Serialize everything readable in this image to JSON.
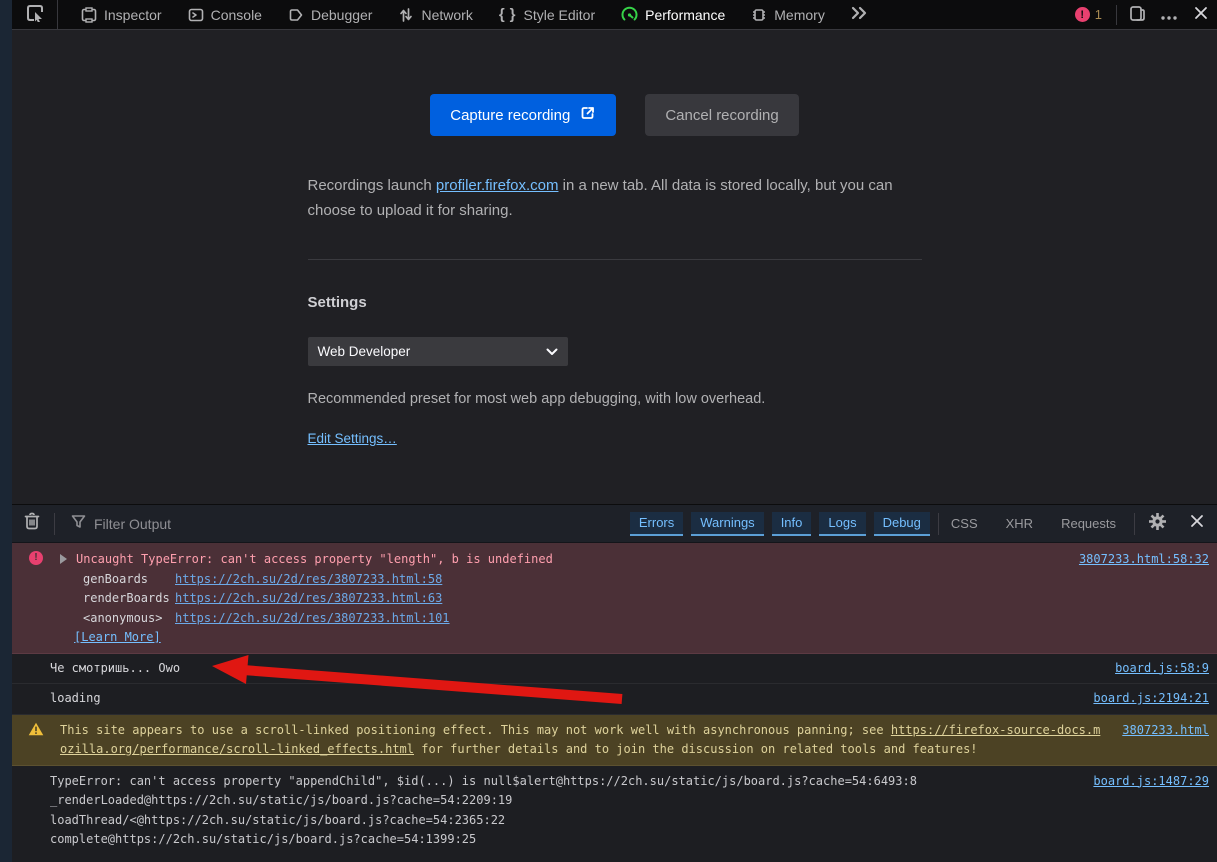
{
  "colors": {
    "accent_blue": "#0060df",
    "link_blue": "#75bfff",
    "error_pink": "#ff9fae",
    "error_badge": "#e8406f",
    "warning_yellow": "#ded29b",
    "performance_green": "#36d348",
    "annotation_arrow_red": "#e01712"
  },
  "toolbar": {
    "tabs": [
      {
        "label": "Inspector"
      },
      {
        "label": "Console"
      },
      {
        "label": "Debugger"
      },
      {
        "label": "Network"
      },
      {
        "label": "Style Editor"
      },
      {
        "label": "Performance",
        "active": true
      },
      {
        "label": "Memory"
      }
    ],
    "error_badge_count": "1"
  },
  "performance_panel": {
    "capture_button": "Capture recording",
    "cancel_button": "Cancel recording",
    "recordings_text_before": "Recordings launch ",
    "recordings_link": "profiler.firefox.com",
    "recordings_text_after": " in a new tab. All data is stored locally, but you can choose to upload it for sharing.",
    "settings_heading": "Settings",
    "preset_select_value": "Web Developer",
    "preset_description": "Recommended preset for most web app debugging, with low overhead.",
    "edit_settings_link": "Edit Settings…"
  },
  "console": {
    "filter_placeholder": "Filter Output",
    "filter_buttons": [
      "Errors",
      "Warnings",
      "Info",
      "Logs",
      "Debug"
    ],
    "category_buttons": [
      "CSS",
      "XHR",
      "Requests"
    ],
    "messages": {
      "error": {
        "text": "Uncaught TypeError: can't access property \"length\", b is undefined",
        "source": "3807233.html:58:32",
        "stack": [
          {
            "fn": "genBoards",
            "loc": "https://2ch.su/2d/res/3807233.html:58"
          },
          {
            "fn": "renderBoards",
            "loc": "https://2ch.su/2d/res/3807233.html:63"
          },
          {
            "fn": "<anonymous>",
            "loc": "https://2ch.su/2d/res/3807233.html:101"
          }
        ],
        "learn_more": "[Learn More]"
      },
      "log1": {
        "text": "Че смотришь... Owo",
        "source": "board.js:58:9"
      },
      "log2": {
        "text": "loading",
        "source": "board.js:2194:21"
      },
      "warning": {
        "text_before": "This site appears to use a scroll-linked positioning effect. This may not work well with asynchronous panning; see ",
        "link": "https://firefox-source-docs.mozilla.org/performance/scroll-linked_effects.html",
        "text_after": " for further details and to join the discussion on related tools and features!",
        "source": "3807233.html"
      },
      "error2": {
        "line1": "TypeError: can't access property \"appendChild\", $id(...) is null$alert@https://2ch.su/static/js/board.js?cache=54:6493:8",
        "line2": "_renderLoaded@https://2ch.su/static/js/board.js?cache=54:2209:19",
        "line3": "loadThread/<@https://2ch.su/static/js/board.js?cache=54:2365:22",
        "line4": "complete@https://2ch.su/static/js/board.js?cache=54:1399:25",
        "source": "board.js:1487:29"
      }
    }
  }
}
